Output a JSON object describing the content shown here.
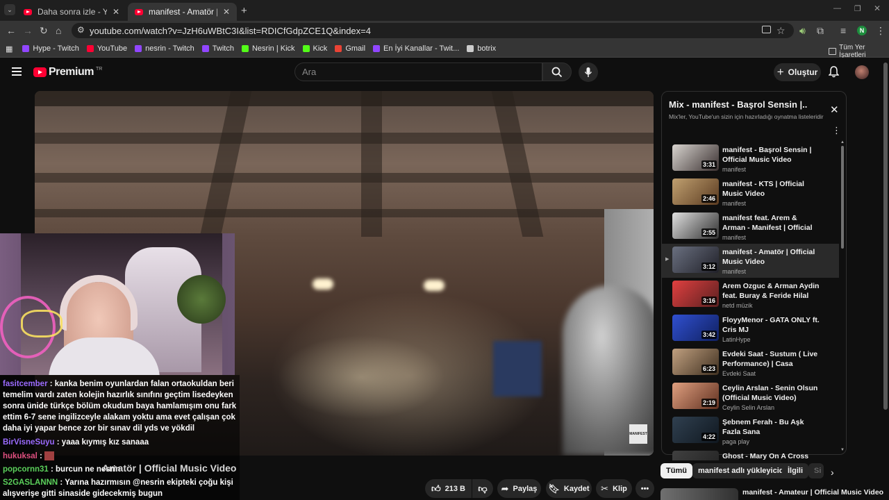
{
  "browser": {
    "tabs": [
      {
        "title": "Daha sonra izle - YouTube",
        "active": false
      },
      {
        "title": "manifest - Amatör | Official Mu",
        "active": true
      }
    ],
    "url": "youtube.com/watch?v=JzH6uWBtC3I&list=RDICfGdpZCE1Q&index=4",
    "profile_initial": "N",
    "bookmarks": [
      {
        "label": "Hype - Twitch",
        "color": "#9146ff"
      },
      {
        "label": "YouTube",
        "color": "#ff0033"
      },
      {
        "label": "nesrin - Twitch",
        "color": "#9146ff"
      },
      {
        "label": "Twitch",
        "color": "#9146ff"
      },
      {
        "label": "Nesrin | Kick",
        "color": "#53fc18"
      },
      {
        "label": "Kick",
        "color": "#53fc18"
      },
      {
        "label": "Gmail",
        "color": "#ea4335"
      },
      {
        "label": "En İyi Kanallar - Twit...",
        "color": "#9146ff"
      },
      {
        "label": "botrix",
        "color": "#cccccc"
      }
    ],
    "all_bookmarks": "Tüm Yer İşaretleri"
  },
  "youtube": {
    "logo": "Premium",
    "logo_region": "TR",
    "search_placeholder": "Ara",
    "create_label": "Oluştur"
  },
  "video": {
    "title": "Amatör | Official Music Video",
    "watermark": "MANIFEST",
    "likes": "213 B",
    "share": "Paylaş",
    "save": "Kaydet",
    "clip": "Klip"
  },
  "chat": [
    {
      "user": "fasitcember",
      "msg": " : kanka benim oyunlardan falan ortaokuldan beri temelim vardı zaten kolejin hazırlık sınıfını geçtim lisedeyken sonra ünide türkçe bölüm okudum baya hamlamışım onu fark ettim 6-7 sene ingilizceyle alakam yoktu ama evet çalışan çok daha iyi yapar bence zor bir sınav dil yds ve yökdil",
      "color": "#9b6bff"
    },
    {
      "user": "BirVisneSuyu",
      "msg": " : yaaa kıymış kız sanaaa",
      "color": "#9b6bff"
    },
    {
      "user": "hukuksal",
      "msg": " : ",
      "color": "#e05080"
    },
    {
      "user": "popcornn31",
      "msg": " : burcun ne nesrin",
      "color": "#5bd05b"
    },
    {
      "user": "S2GASLANNN",
      "msg": " : Yarına hazırmısın @nesrin ekipteki çoğu kişi alışverişe gitti sinaside gidecekmiş bugun",
      "color": "#5bd05b"
    }
  ],
  "playlist": {
    "title": "Mix - manifest - Başrol Sensin |...",
    "subtitle": "Mix'ler, YouTube'un sizin için hazırladığı oynatma listeleridir",
    "items": [
      {
        "title": "manifest - Başrol Sensin | Official Music Video",
        "channel": "manifest",
        "duration": "3:31",
        "active": false,
        "c1": "#d8d4cf",
        "c2": "#3a3030"
      },
      {
        "title": "manifest - KTS | Official Music Video",
        "channel": "manifest",
        "duration": "2:46",
        "active": false,
        "c1": "#c0a070",
        "c2": "#5a3a20"
      },
      {
        "title": "manifest feat. Arem & Arman - Manifest | Official Dance Video",
        "channel": "manifest",
        "duration": "2:55",
        "active": false,
        "c1": "#e0e0e0",
        "c2": "#303030"
      },
      {
        "title": "manifest - Amatör | Official Music Video",
        "channel": "manifest",
        "duration": "3:12",
        "active": true,
        "c1": "#6a7080",
        "c2": "#202028"
      },
      {
        "title": "Arem Ozguc & Arman Aydin feat. Buray & Feride Hilal Akın...",
        "channel": "netd müzik",
        "duration": "3:16",
        "active": false,
        "c1": "#e04040",
        "c2": "#5a2020"
      },
      {
        "title": "FloyyMenor - GATA ONLY ft. Cris MJ",
        "channel": "LatinHype",
        "duration": "3:42",
        "active": false,
        "c1": "#3050d0",
        "c2": "#102060"
      },
      {
        "title": "Evdeki Saat - Sustum ( Live Performance) | Casa Sunsets...",
        "channel": "Evdeki Saat",
        "duration": "6:23",
        "active": false,
        "c1": "#c0a080",
        "c2": "#403020"
      },
      {
        "title": "Ceylin Arslan - Senin Olsun (Official Music Video)",
        "channel": "Ceylin Selin Arslan",
        "duration": "2:19",
        "active": false,
        "c1": "#e0a080",
        "c2": "#603020"
      },
      {
        "title": "Şebnem Ferah - Bu Aşk Fazla Sana",
        "channel": "paga play",
        "duration": "4:22",
        "active": false,
        "c1": "#304050",
        "c2": "#101820"
      },
      {
        "title": "Ghost - Mary On A Cross",
        "channel": "",
        "duration": "",
        "active": false,
        "c1": "#404040",
        "c2": "#202020"
      }
    ]
  },
  "chips": [
    "Tümü",
    "manifest adlı yükleyiciden",
    "İlgili",
    "Si"
  ],
  "next_video": {
    "title": "manifest - Amateur | Official Music Video"
  }
}
